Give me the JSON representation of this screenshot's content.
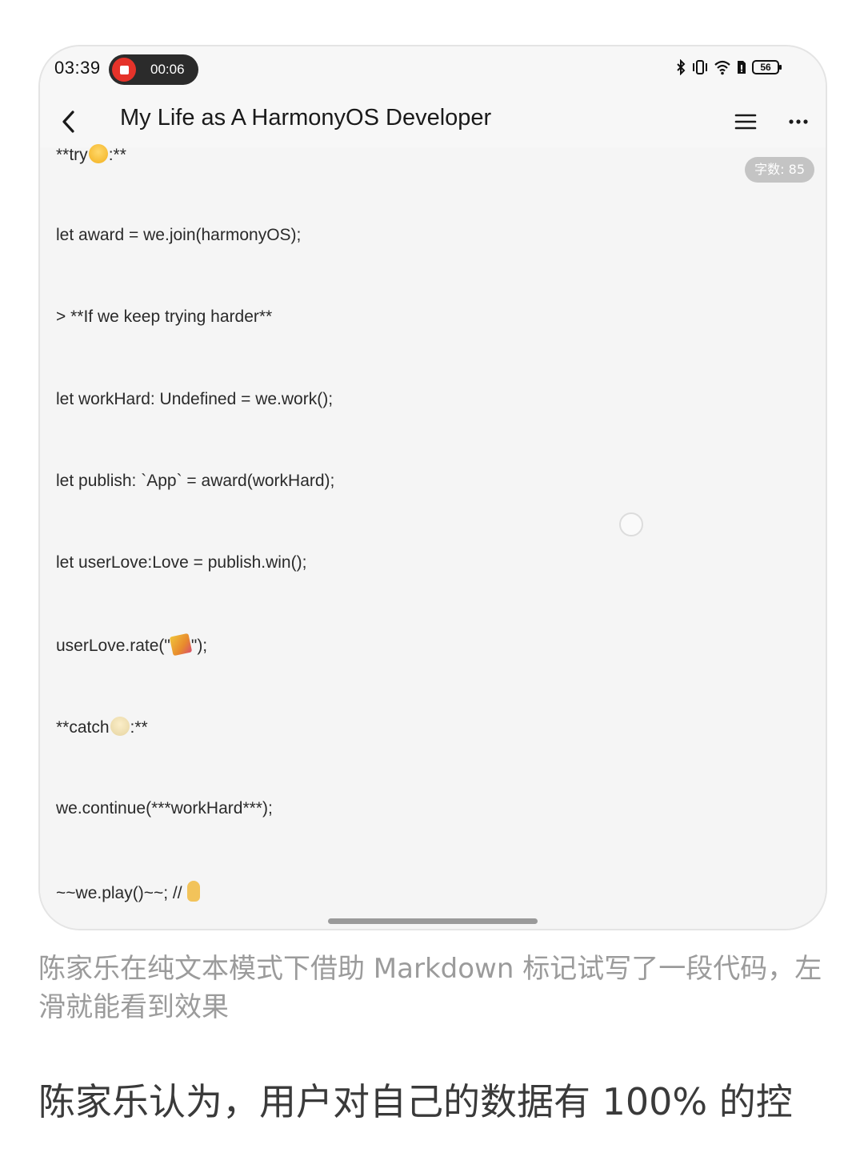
{
  "status_bar": {
    "time": "03:39",
    "recording_time": "00:06",
    "battery_level": "56",
    "icons": [
      "bluetooth-icon",
      "vibrate-icon",
      "wifi-icon",
      "sim-icon",
      "battery-icon"
    ]
  },
  "app_bar": {
    "title": "My Life as A HarmonyOS Developer",
    "back_icon": "chevron-left-icon",
    "menu_icon": "hamburger-menu-icon",
    "more_icon": "more-horizontal-icon"
  },
  "editor": {
    "word_count": "字数: 85",
    "lines": [
      {
        "pre": "**try",
        "emoji": "grin",
        "post": ":**"
      },
      {
        "pre": "let award = we.join(harmonyOS);",
        "emoji": null,
        "post": ""
      },
      {
        "pre": "> **If we keep trying harder**",
        "emoji": null,
        "post": ""
      },
      {
        "pre": "let workHard: Undefined = we.work();",
        "emoji": null,
        "post": ""
      },
      {
        "pre": "let publish: `App` = award(workHard);",
        "emoji": null,
        "post": ""
      },
      {
        "pre": "let userLove:Love =  publish.win();",
        "emoji": null,
        "post": ""
      },
      {
        "pre": "userLove.rate(\"",
        "emoji": "party",
        "post": "\");"
      },
      {
        "pre": "**catch",
        "emoji": "sweat",
        "post": ":**"
      },
      {
        "pre": "we.continue(***workHard***);",
        "emoji": null,
        "post": ""
      },
      {
        "pre": "~~we.play()~~; // ",
        "emoji": "hand",
        "post": ""
      }
    ]
  },
  "caption": "陈家乐在纯文本模式下借助 Markdown 标记试写了一段代码，左滑就能看到效果",
  "body_text": "陈家乐认为，用户对自己的数据有 100% 的控"
}
